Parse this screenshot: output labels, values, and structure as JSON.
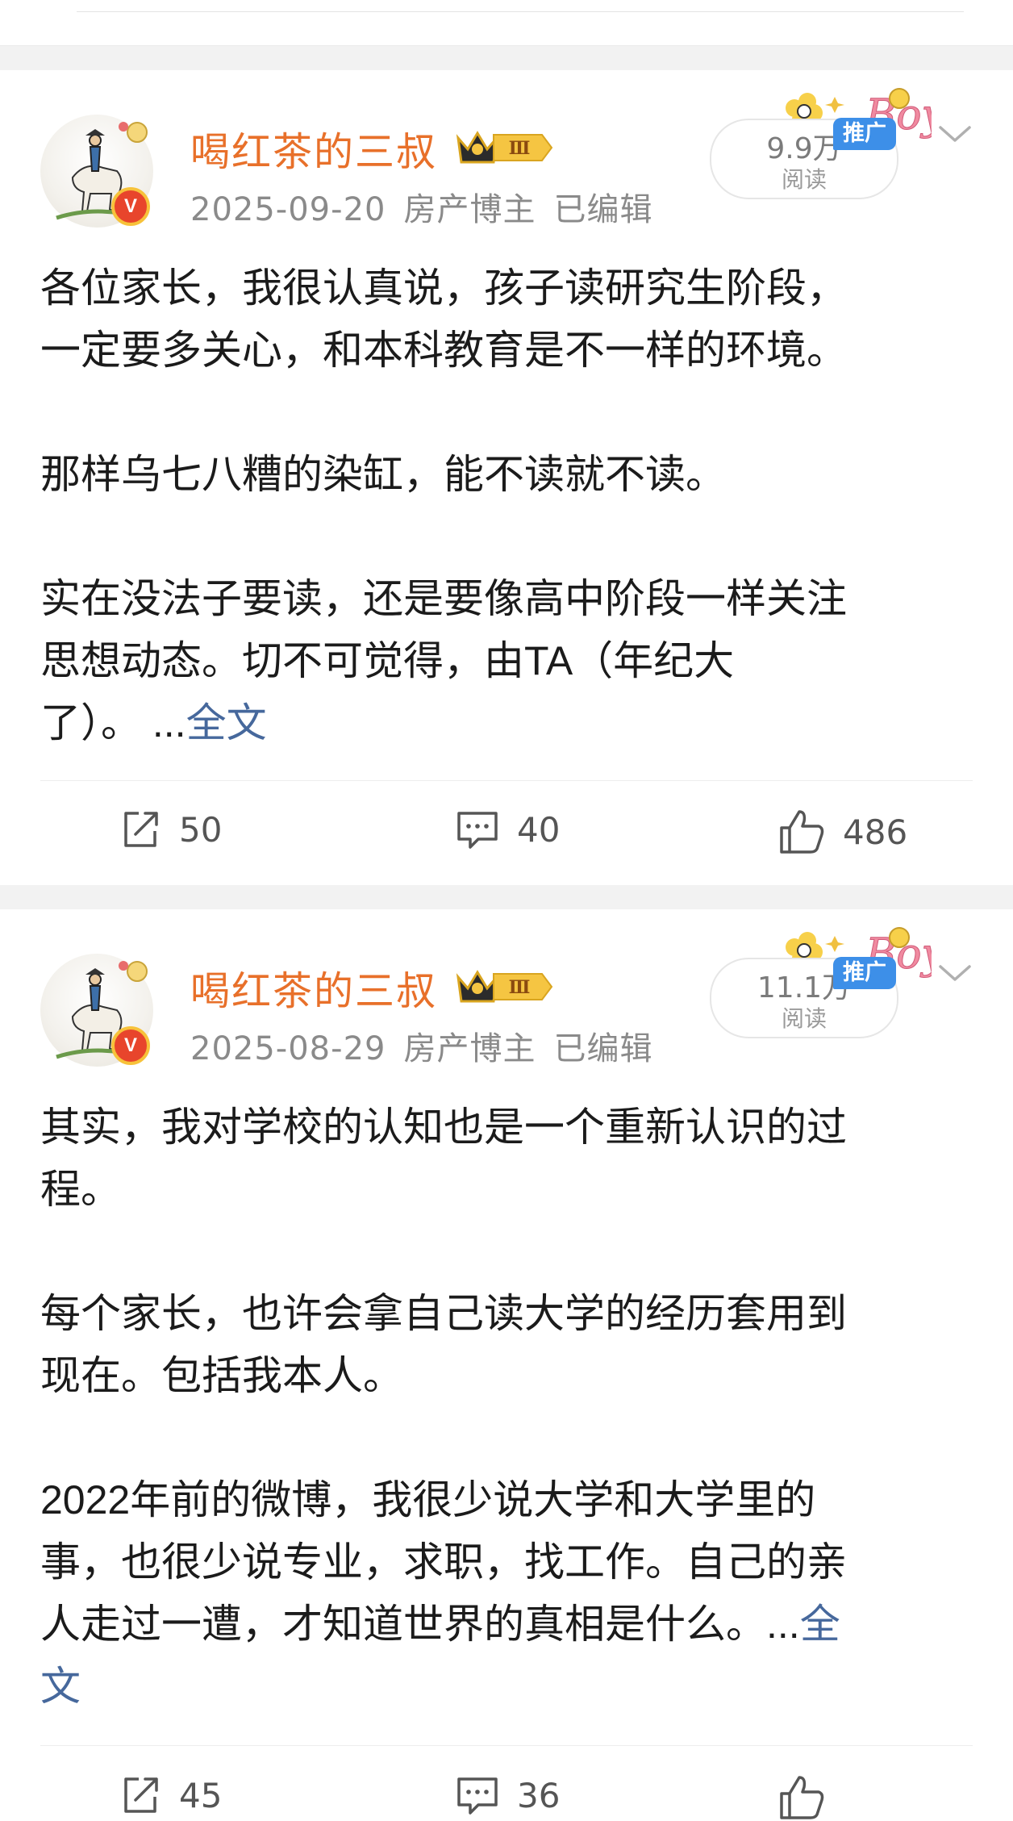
{
  "post1": {
    "author": "喝红茶的三叔",
    "level_badge": "Ⅲ",
    "verified_mark": "V",
    "date": "2025-09-20",
    "tag": "房产博主",
    "edited": "已编辑",
    "reads_count": "9.9万",
    "reads_label": "阅读",
    "promo_label": "推广",
    "body_lines": [
      "各位家长，我很认真说，孩子读研究生阶段，",
      "一定要多关心，和本科教育是不一样的环境。",
      "",
      "那样乌七八糟的染缸，能不读就不读。",
      "",
      "实在没法子要读，还是要像高中阶段一样关注",
      "思想动态。切不可觉得，由TA（年纪大"
    ],
    "last_line": "了）。 ...",
    "more_label": "全文",
    "repost_count": "50",
    "comment_count": "40",
    "like_count": "486"
  },
  "post2": {
    "author": "喝红茶的三叔",
    "level_badge": "Ⅲ",
    "verified_mark": "V",
    "date": "2025-08-29",
    "tag": "房产博主",
    "edited": "已编辑",
    "reads_count": "11.1万",
    "reads_label": "阅读",
    "promo_label": "推广",
    "body_lines": [
      "其实，我对学校的认知也是一个重新认识的过",
      "程。",
      "",
      "每个家长，也许会拿自己读大学的经历套用到",
      "现在。包括我本人。",
      "",
      "2022年前的微博，我很少说大学和大学里的",
      "事，也很少说专业，求职，找工作。自己的亲"
    ],
    "last_line": "人走过一遭，才知道世界的真相是什么。...",
    "more_label_1": "全",
    "more_label_2": "文",
    "repost_count": "45",
    "comment_count": "36"
  },
  "colors": {
    "author": "#e8702a",
    "link": "#46689c",
    "promo": "#3d8fe8",
    "verified": "#e8452c"
  },
  "icons": [
    "repost-icon",
    "comment-icon",
    "like-icon",
    "chevron-down-icon",
    "crown-icon"
  ]
}
